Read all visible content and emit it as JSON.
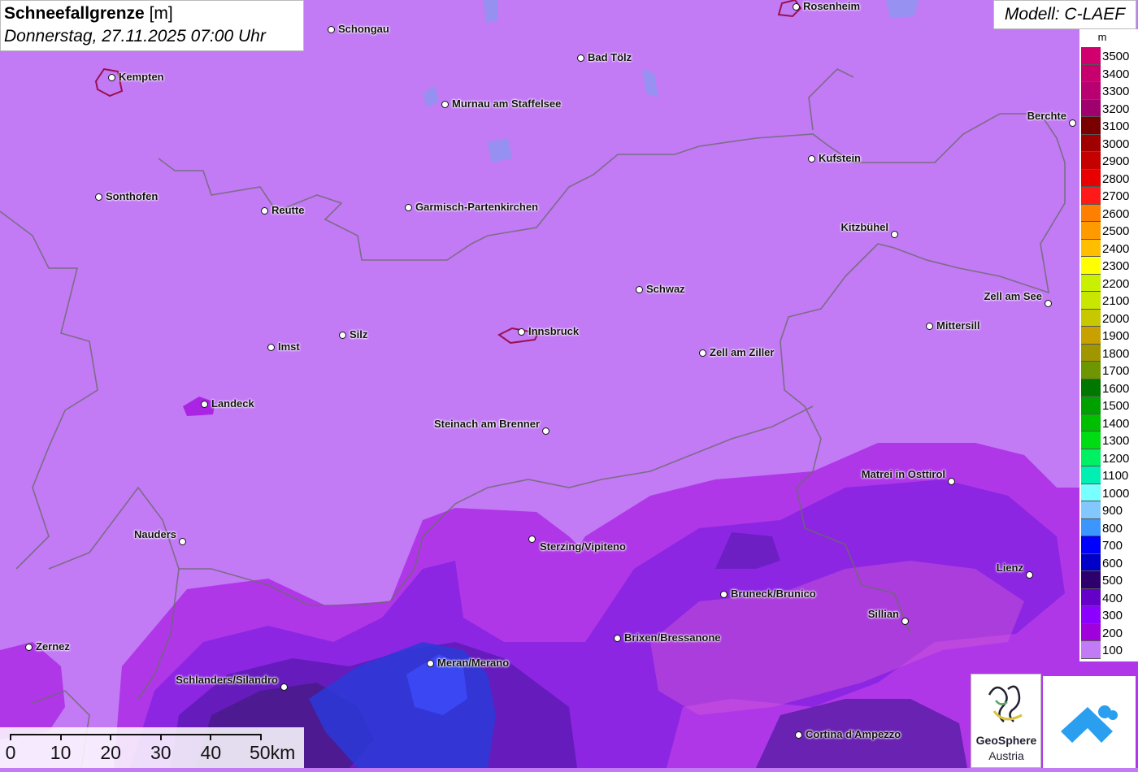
{
  "title": {
    "main": "Schneefallgrenze",
    "unit": "[m]",
    "date": "Donnerstag, 27.11.2025 07:00 Uhr"
  },
  "model": "Modell: C-LAEF",
  "legend": {
    "unit": "m",
    "items": [
      {
        "label": "3500",
        "color": "#d1006e"
      },
      {
        "label": "3400",
        "color": "#c8006e"
      },
      {
        "label": "3300",
        "color": "#b80070"
      },
      {
        "label": "3200",
        "color": "#a0006e"
      },
      {
        "label": "3100",
        "color": "#7a0000"
      },
      {
        "label": "3000",
        "color": "#a00000"
      },
      {
        "label": "2900",
        "color": "#c40000"
      },
      {
        "label": "2800",
        "color": "#e80000"
      },
      {
        "label": "2700",
        "color": "#ff1a1a"
      },
      {
        "label": "2600",
        "color": "#ff7f00"
      },
      {
        "label": "2500",
        "color": "#ff9a00"
      },
      {
        "label": "2400",
        "color": "#ffbf00"
      },
      {
        "label": "2300",
        "color": "#ffff00"
      },
      {
        "label": "2200",
        "color": "#c8f000"
      },
      {
        "label": "2100",
        "color": "#c8e600"
      },
      {
        "label": "2000",
        "color": "#c8c800"
      },
      {
        "label": "1900",
        "color": "#c8a000"
      },
      {
        "label": "1800",
        "color": "#a09600"
      },
      {
        "label": "1700",
        "color": "#6e9600"
      },
      {
        "label": "1600",
        "color": "#007800"
      },
      {
        "label": "1500",
        "color": "#00a000"
      },
      {
        "label": "1400",
        "color": "#00be00"
      },
      {
        "label": "1300",
        "color": "#00dc14"
      },
      {
        "label": "1200",
        "color": "#00f064"
      },
      {
        "label": "1100",
        "color": "#00f0b4"
      },
      {
        "label": "1000",
        "color": "#78ffff"
      },
      {
        "label": "900",
        "color": "#82c8ff"
      },
      {
        "label": "800",
        "color": "#3c96ff"
      },
      {
        "label": "700",
        "color": "#0000ff"
      },
      {
        "label": "600",
        "color": "#0000c8"
      },
      {
        "label": "500",
        "color": "#2d006e"
      },
      {
        "label": "400",
        "color": "#6400c8"
      },
      {
        "label": "300",
        "color": "#8c00ff"
      },
      {
        "label": "200",
        "color": "#a000dc"
      },
      {
        "label": "100",
        "color": "#c27af5"
      }
    ]
  },
  "cities": [
    {
      "name": "Rosenheim"
    },
    {
      "name": "Schongau"
    },
    {
      "name": "Kempten"
    },
    {
      "name": "Bad Tölz"
    },
    {
      "name": "Murnau am Staffelsee"
    },
    {
      "name": "Berchte"
    },
    {
      "name": "Kufstein"
    },
    {
      "name": "Sonthofen"
    },
    {
      "name": "Reutte"
    },
    {
      "name": "Garmisch-Partenkirchen"
    },
    {
      "name": "Kitzbühel"
    },
    {
      "name": "Schwaz"
    },
    {
      "name": "Zell am See"
    },
    {
      "name": "Mittersill"
    },
    {
      "name": "Silz"
    },
    {
      "name": "Innsbruck"
    },
    {
      "name": "Imst"
    },
    {
      "name": "Zell am Ziller"
    },
    {
      "name": "Landeck"
    },
    {
      "name": "Steinach am Brenner"
    },
    {
      "name": "Matrei in Osttirol"
    },
    {
      "name": "Nauders"
    },
    {
      "name": "Sterzing/Vipiteno"
    },
    {
      "name": "Lienz"
    },
    {
      "name": "Bruneck/Brunico"
    },
    {
      "name": "Sillian"
    },
    {
      "name": "Zernez"
    },
    {
      "name": "Brixen/Bressanone"
    },
    {
      "name": "Meran/Merano"
    },
    {
      "name": "Schlanders/Silandro"
    },
    {
      "name": "Cortina d'Ampezzo"
    }
  ],
  "scale": {
    "labels": [
      "0",
      "10",
      "20",
      "30",
      "40",
      "50km"
    ]
  },
  "logos": {
    "geosphere_line1": "GeoSphere",
    "geosphere_line2": "Austria"
  }
}
